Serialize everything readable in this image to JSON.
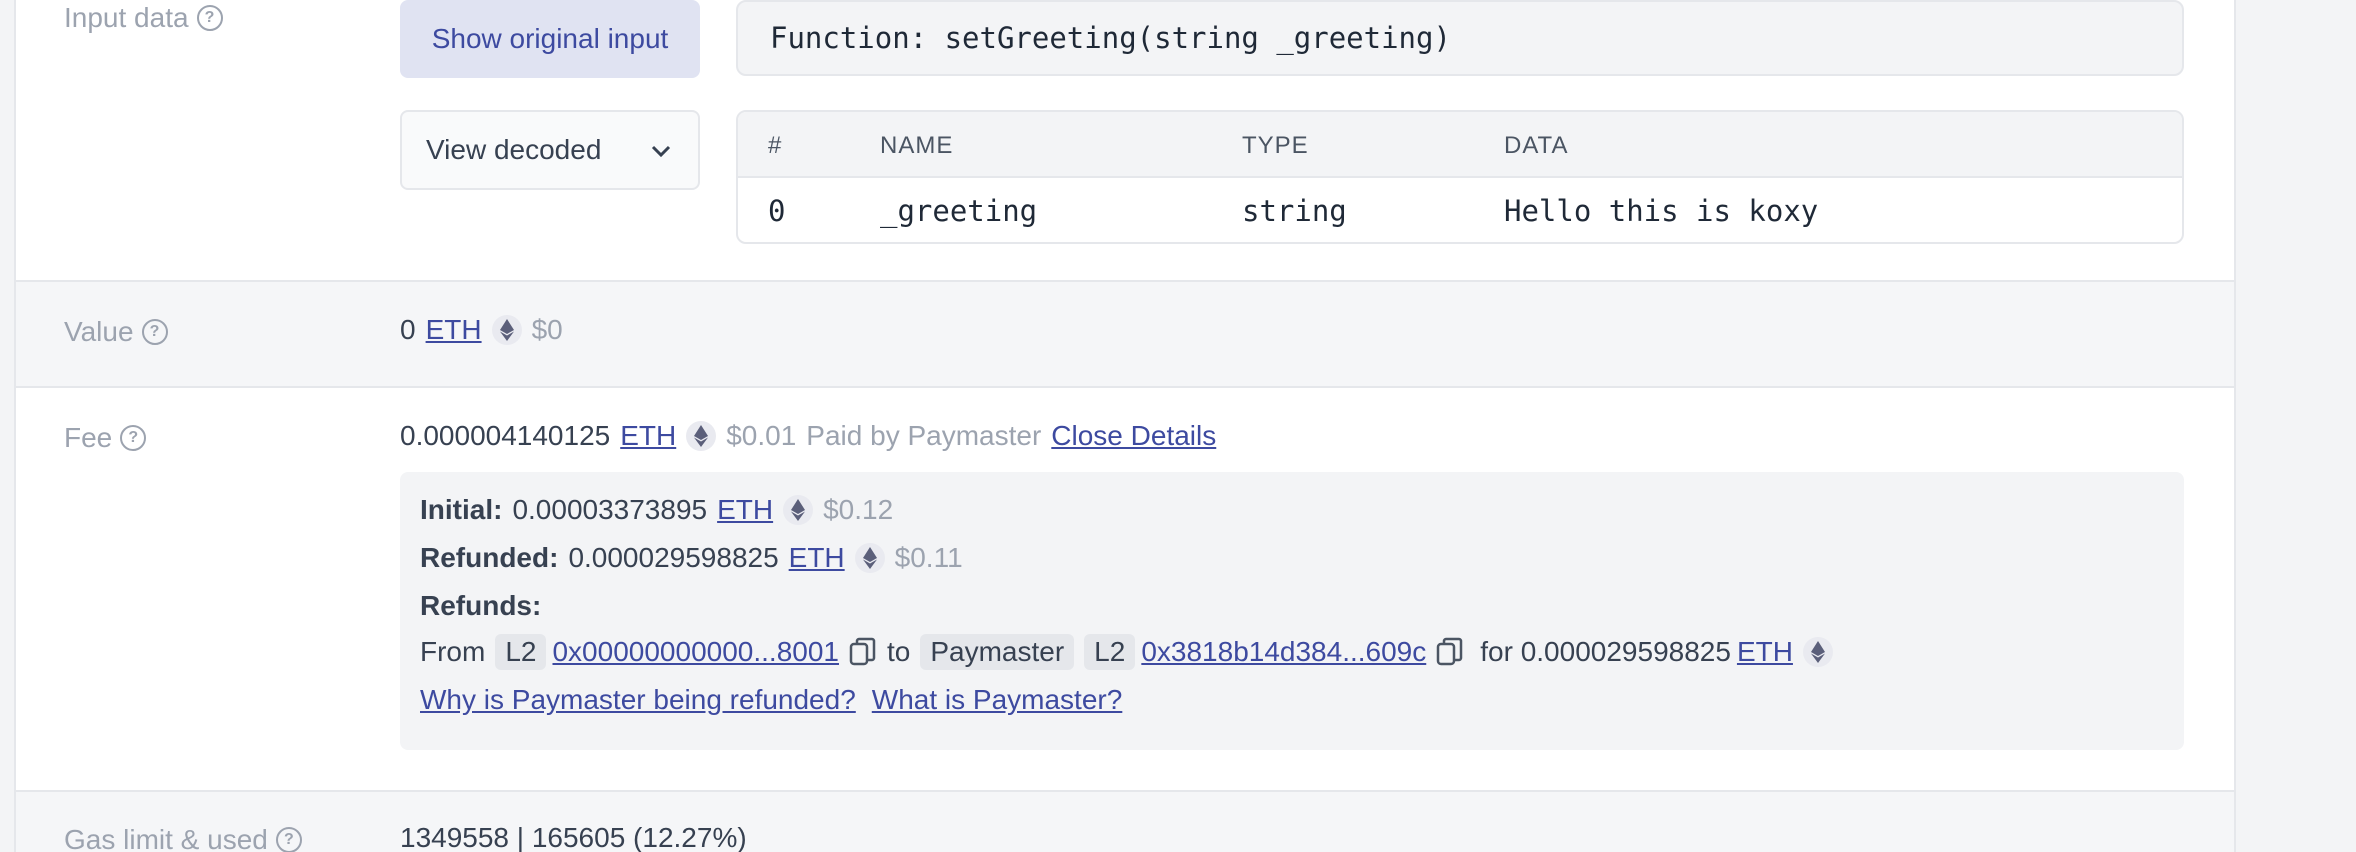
{
  "input_data": {
    "label": "Input data",
    "show_original_button": "Show original input",
    "function_signature": "Function: setGreeting(string _greeting)",
    "view_mode": "View decoded",
    "table": {
      "headers": [
        "#",
        "NAME",
        "TYPE",
        "DATA"
      ],
      "rows": [
        {
          "index": "0",
          "name": "_greeting",
          "type": "string",
          "data": "Hello this is koxy"
        }
      ]
    }
  },
  "value": {
    "label": "Value",
    "amount": "0",
    "currency": "ETH",
    "usd": "$0"
  },
  "fee": {
    "label": "Fee",
    "amount": "0.000004140125",
    "currency": "ETH",
    "usd": "$0.01",
    "paid_by": "Paid by Paymaster",
    "close_details": "Close Details",
    "initial_label": "Initial:",
    "initial_amount": "0.00003373895",
    "initial_usd": "$0.12",
    "refunded_label": "Refunded:",
    "refunded_amount": "0.000029598825",
    "refunded_usd": "$0.11",
    "refunds_label": "Refunds:",
    "refund": {
      "from_word": "From",
      "from_layer": "L2",
      "from_address": "0x00000000000...8001",
      "to_word": "to",
      "to_tag": "Paymaster",
      "to_layer": "L2",
      "to_address": "0x3818b14d384...609c",
      "for_text": "for 0.000029598825",
      "currency": "ETH"
    },
    "why_link": "Why is Paymaster being refunded?",
    "what_link": "What is Paymaster?"
  },
  "gas": {
    "label": "Gas limit & used",
    "value": "1349558 | 165605 (12.27%)"
  },
  "icons": [
    "help-icon",
    "chevron-down-icon",
    "eth-icon",
    "copy-icon"
  ],
  "colors": {
    "accent": "#3d4aa0",
    "muted": "#9ca3af",
    "panel": "#f3f4f6"
  }
}
